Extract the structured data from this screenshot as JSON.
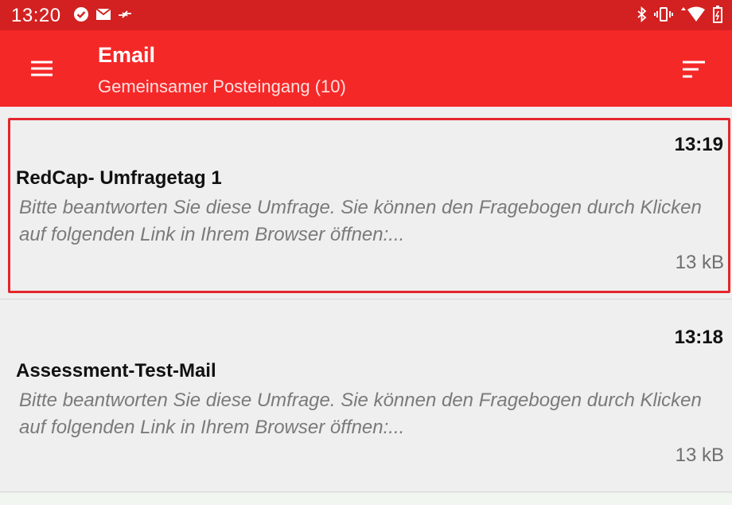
{
  "status_bar": {
    "time": "13:20",
    "left_icons": [
      "check-circle-icon",
      "mail-icon",
      "data-transfer-icon"
    ],
    "right_icons": [
      "bluetooth-icon",
      "vibrate-icon",
      "wifi-icon",
      "battery-icon"
    ]
  },
  "app_bar": {
    "title": "Email",
    "subtitle": "Gemeinsamer Posteingang (10)",
    "color": "#f52828",
    "status_color": "#d32121"
  },
  "emails": [
    {
      "time": "13:19",
      "subject": "RedCap- Umfragetag 1",
      "preview": "Bitte beantworten Sie diese Umfrage. Sie können den Fragebogen durch Klicken auf folgenden Link in Ihrem Browser öffnen:...",
      "size": "13 kB",
      "selected": true
    },
    {
      "time": "13:18",
      "subject": "Assessment-Test-Mail",
      "preview": "Bitte beantworten Sie diese Umfrage. Sie können den Fragebogen durch Klicken auf folgenden Link in Ihrem Browser öffnen:...",
      "size": "13 kB",
      "selected": false
    }
  ]
}
